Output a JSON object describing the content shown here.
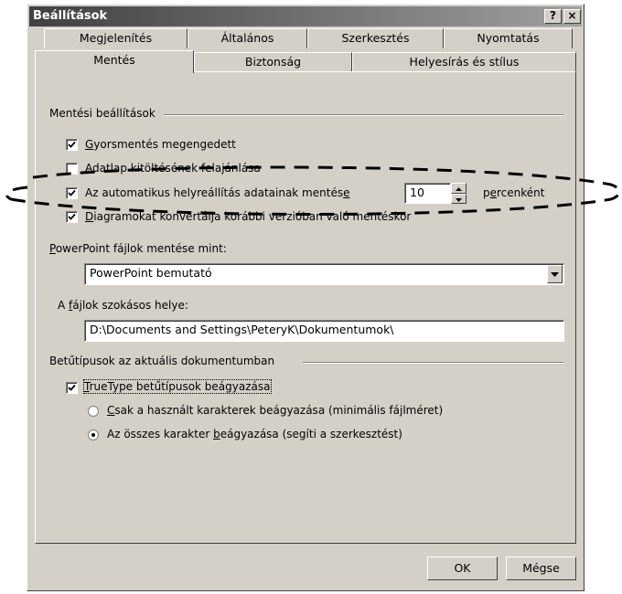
{
  "window": {
    "title": "Beállítások",
    "help_label": "?",
    "close_label": "×"
  },
  "tabs_back": [
    "Megjelenítés",
    "Általános",
    "Szerkesztés",
    "Nyomtatás"
  ],
  "tabs_front": [
    "Mentés",
    "Biztonság",
    "Helyesírás és stílus"
  ],
  "save_options": {
    "group_label": "Mentési beállítások",
    "fast_save": {
      "pre": "",
      "accel": "G",
      "post": "yorsmentés megengedett",
      "checked": true
    },
    "prompt_props": {
      "pre": "",
      "accel": "A",
      "post": "datlap kitöltésének felajánlása",
      "checked": false
    },
    "autorecover": {
      "pre": "Az automatikus helyreállítás adatainak mentés",
      "accel": "e",
      "post": "",
      "checked": true,
      "value": "10",
      "unit_pre": "p",
      "unit_accel": "e",
      "unit_post": "rcenként"
    },
    "convert_charts": {
      "pre": "",
      "accel": "D",
      "post": "iagramokat konvertálja korábbi verzióban való mentéskor",
      "checked": true
    }
  },
  "save_as": {
    "label_pre": "",
    "label_accel": "P",
    "label_post": "owerPoint fájlok mentése mint:",
    "value": "PowerPoint bemutató"
  },
  "default_location": {
    "label_pre": "A ",
    "label_accel": "f",
    "label_post": "ájlok szokásos helye:",
    "value": "D:\\Documents and Settings\\PeteryK\\Dokumentumok\\"
  },
  "fonts": {
    "group_label": "Betűtípusok az aktuális dokumentumban",
    "embed": {
      "pre": "",
      "accel": "T",
      "post": "rueType betűtípusok beágyazása",
      "checked": true
    },
    "only_used": {
      "pre": "",
      "accel": "C",
      "post": "sak a használt karakterek beágyazása (minimális fájlméret)",
      "selected": false
    },
    "all_chars": {
      "pre": "Az összes karakter ",
      "accel": "b",
      "post": "eágyazása (segíti a szerkesztést)",
      "selected": true
    }
  },
  "buttons": {
    "ok": "OK",
    "cancel": "Mégse"
  }
}
